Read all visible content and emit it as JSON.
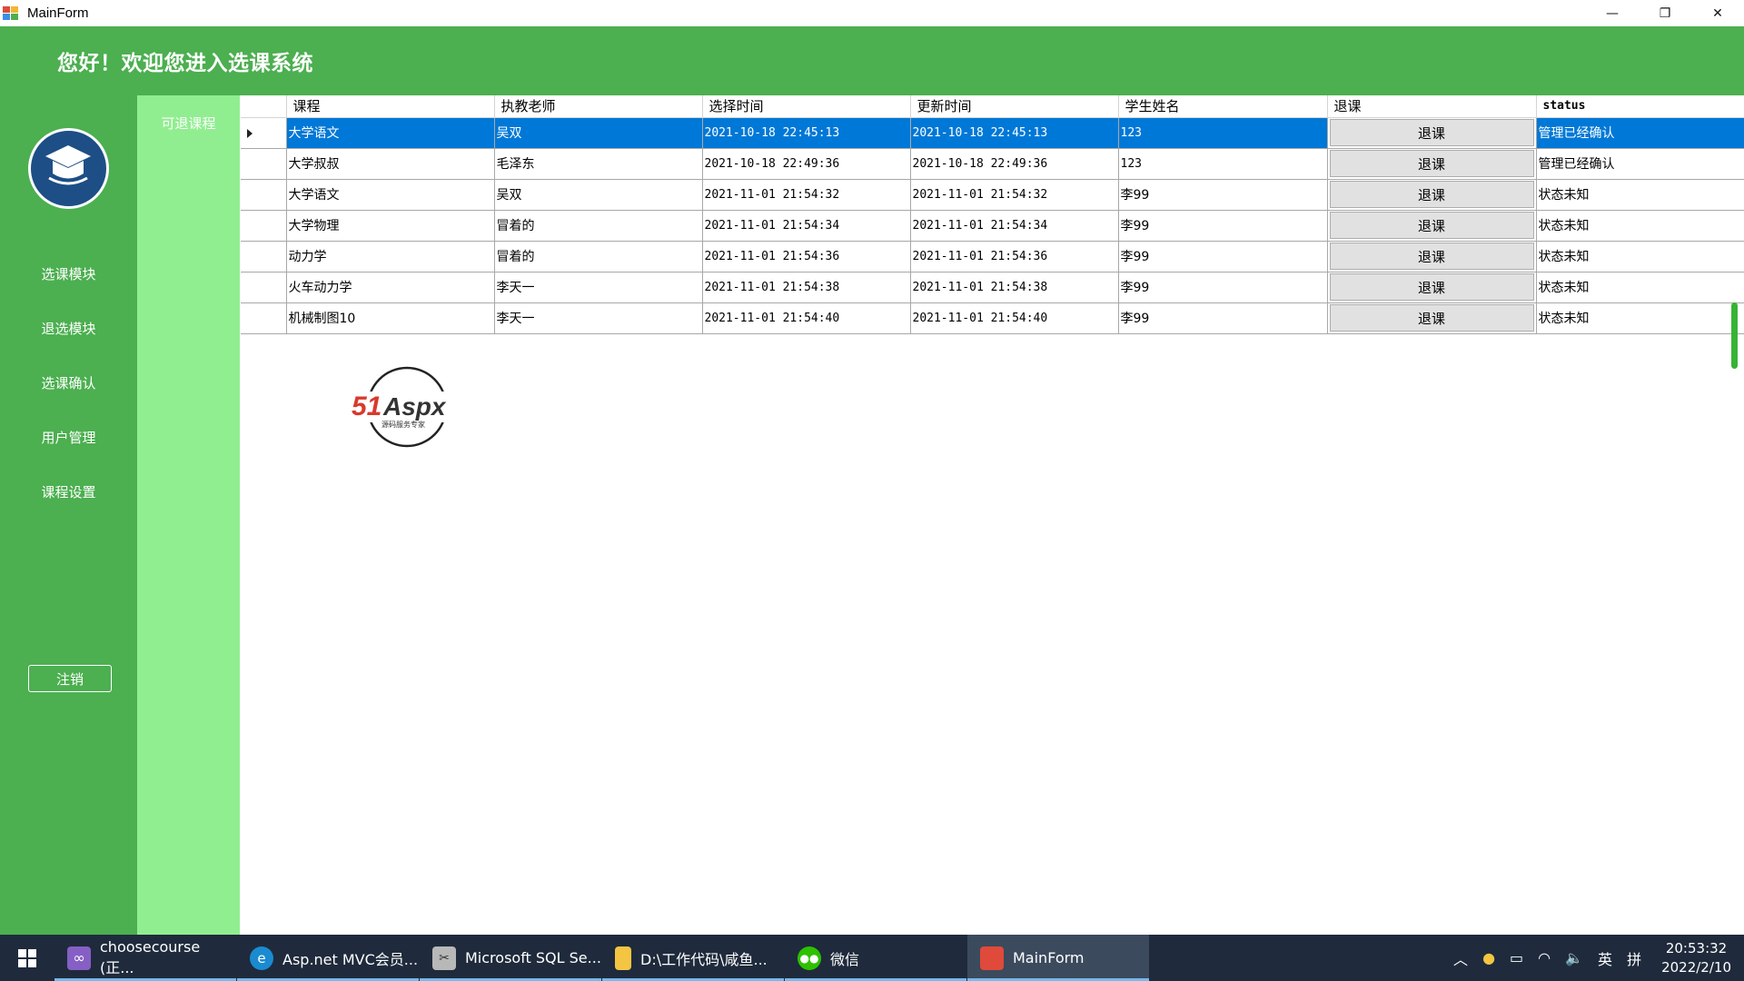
{
  "window": {
    "title": "MainForm",
    "controls": [
      "—",
      "❐",
      "✕"
    ]
  },
  "header": {
    "title": "您好！欢迎您进入选课系统"
  },
  "sidebar": {
    "items": [
      {
        "label": "选课模块"
      },
      {
        "label": "退选模块"
      },
      {
        "label": "选课确认"
      },
      {
        "label": "用户管理"
      },
      {
        "label": "课程设置"
      }
    ],
    "logout_label": "注销"
  },
  "subnav": {
    "item": "可退课程"
  },
  "grid": {
    "columns": [
      "课程",
      "执教老师",
      "选择时间",
      "更新时间",
      "学生姓名",
      "退课",
      "status"
    ],
    "button_label": "退课",
    "rows": [
      {
        "course": "大学语文",
        "teacher": "吴双",
        "select_time": "2021-10-18 22:45:13",
        "update_time": "2021-10-18 22:45:13",
        "student": "123",
        "status": "管理已经确认",
        "selected": true
      },
      {
        "course": "大学叔叔",
        "teacher": "毛泽东",
        "select_time": "2021-10-18 22:49:36",
        "update_time": "2021-10-18 22:49:36",
        "student": "123",
        "status": "管理已经确认"
      },
      {
        "course": "大学语文",
        "teacher": "吴双",
        "select_time": "2021-11-01 21:54:32",
        "update_time": "2021-11-01 21:54:32",
        "student": "李99",
        "status": "状态未知"
      },
      {
        "course": "大学物理",
        "teacher": "冒着的",
        "select_time": "2021-11-01 21:54:34",
        "update_time": "2021-11-01 21:54:34",
        "student": "李99",
        "status": "状态未知"
      },
      {
        "course": "动力学",
        "teacher": "冒着的",
        "select_time": "2021-11-01 21:54:36",
        "update_time": "2021-11-01 21:54:36",
        "student": "李99",
        "status": "状态未知"
      },
      {
        "course": "火车动力学",
        "teacher": "李天一",
        "select_time": "2021-11-01 21:54:38",
        "update_time": "2021-11-01 21:54:38",
        "student": "李99",
        "status": "状态未知"
      },
      {
        "course": "机械制图10",
        "teacher": "李天一",
        "select_time": "2021-11-01 21:54:40",
        "update_time": "2021-11-01 21:54:40",
        "student": "李99",
        "status": "状态未知"
      }
    ]
  },
  "watermark": {
    "brand": "51Aspx",
    "sub": "源码服务专家"
  },
  "taskbar": {
    "apps": [
      {
        "label": "choosecourse (正...",
        "icon": "visual-studio-icon",
        "color": "#865fc5",
        "active": false
      },
      {
        "label": "Asp.net MVC会员...",
        "icon": "edge-icon",
        "color": "#1a8bd1",
        "active": false
      },
      {
        "label": "Microsoft SQL Se...",
        "icon": "sql-server-icon",
        "color": "#b8b8b8",
        "active": false
      },
      {
        "label": "D:\\工作代码\\咸鱼...",
        "icon": "folder-icon",
        "color": "#f4c542",
        "active": false
      },
      {
        "label": "微信",
        "icon": "wechat-icon",
        "color": "#2dc100",
        "active": false
      },
      {
        "label": "MainForm",
        "icon": "winform-icon",
        "color": "#e04a3a",
        "active": true
      }
    ],
    "tray": {
      "input_lang": "英",
      "ime": "拼",
      "time": "20:53:32",
      "date": "2022/2/10"
    }
  },
  "colors": {
    "primary_green": "#4caf50",
    "light_green": "#90ee90",
    "selection_blue": "#0078d7",
    "taskbar": "#1f2b3c"
  }
}
